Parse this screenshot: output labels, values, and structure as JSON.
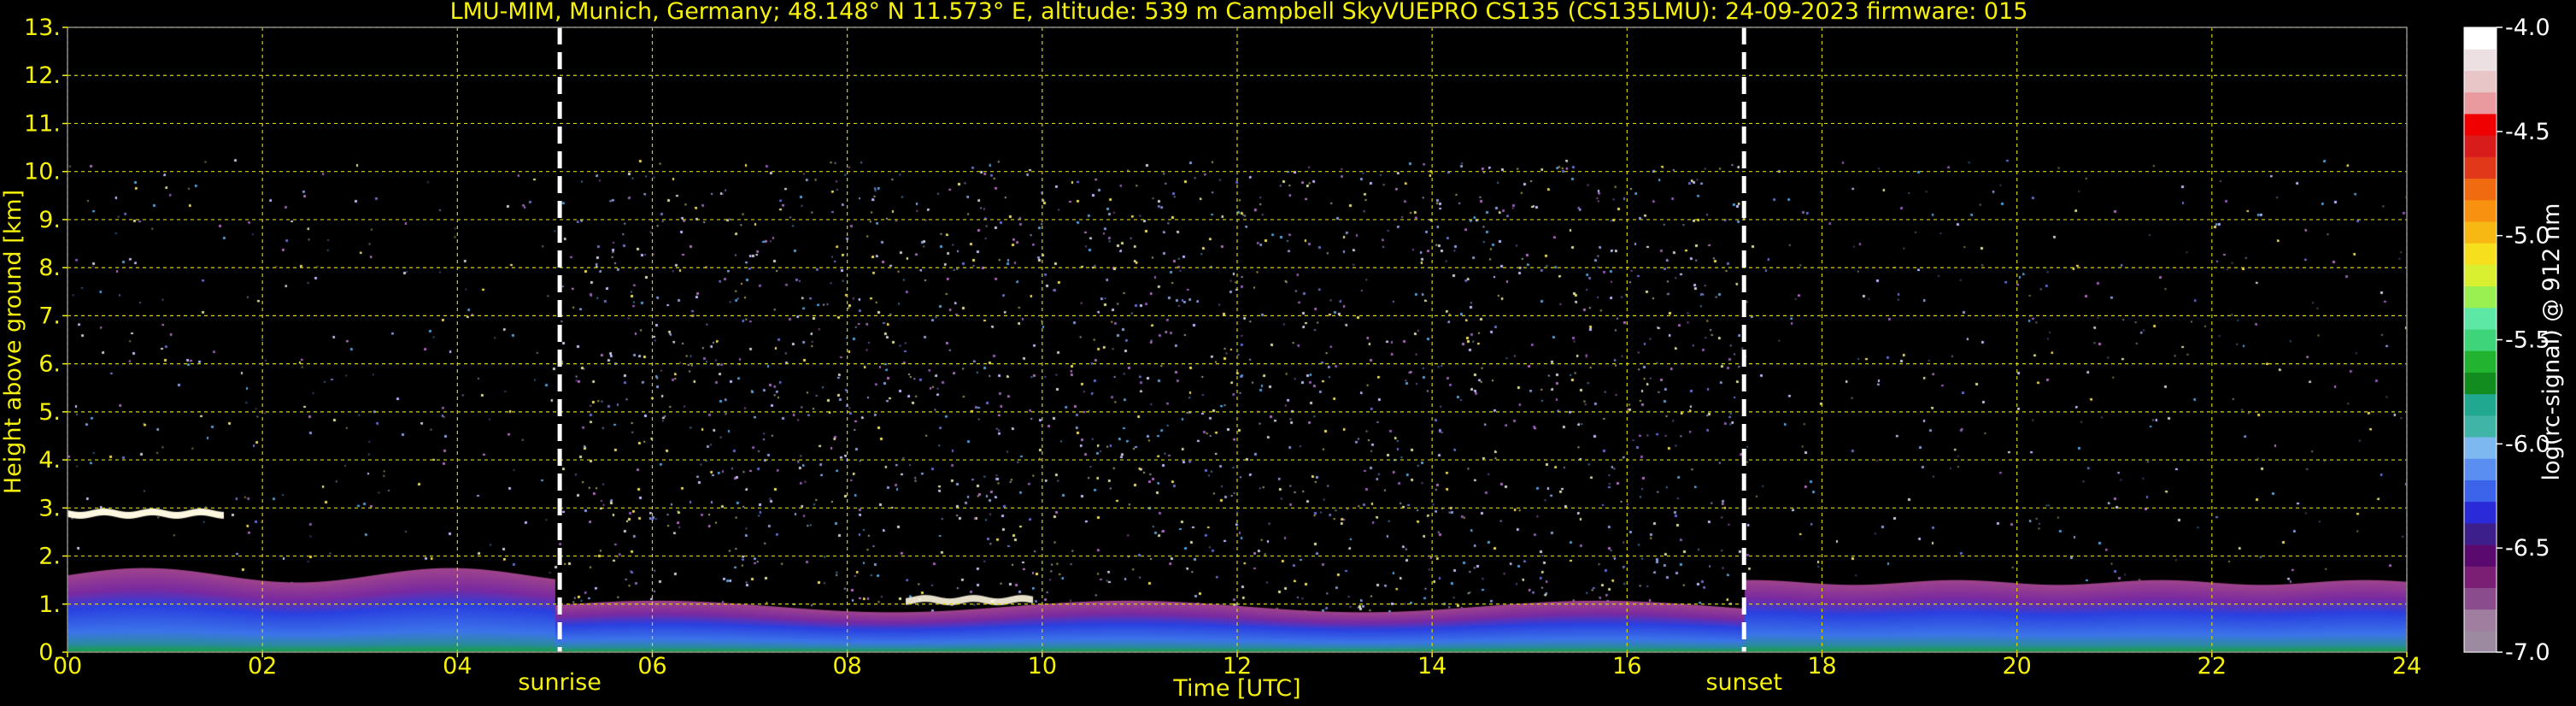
{
  "chart_data": {
    "type": "heatmap",
    "title": "LMU-MIM, Munich, Germany; 48.148° N 11.573° E, altitude: 539 m    Campbell SkyVUEPRO CS135 (CS135LMU): 24-09-2023    firmware: 015",
    "xlabel": "Time [UTC]",
    "ylabel": "Height above ground [km]",
    "xlim": [
      0,
      24
    ],
    "ylim": [
      0,
      13
    ],
    "x_ticks": [
      "00",
      "02",
      "04",
      "06",
      "08",
      "10",
      "12",
      "14",
      "16",
      "18",
      "20",
      "22",
      "24"
    ],
    "y_ticks": [
      "0.",
      "1.",
      "2.",
      "3.",
      "4.",
      "5.",
      "6.",
      "7.",
      "8.",
      "9.",
      "10.",
      "11.",
      "12.",
      "13."
    ],
    "grid": true,
    "markers": [
      {
        "label": "sunrise",
        "time": 5.05
      },
      {
        "label": "sunset",
        "time": 17.2
      }
    ],
    "colorbar": {
      "label": "log(rc-signal) @ 912 nm",
      "range": [
        -7.0,
        -4.0
      ],
      "ticks": [
        "-4.0",
        "-4.5",
        "-5.0",
        "-5.5",
        "-6.0",
        "-6.5",
        "-7.0"
      ],
      "colors": [
        "#9c8aa0",
        "#a07ea0",
        "#8a4c8c",
        "#7a1f74",
        "#5a0a6e",
        "#3d1f8c",
        "#2a2ad8",
        "#3c64ea",
        "#5a8ef0",
        "#7eb8f0",
        "#40b4a6",
        "#20a890",
        "#128c1e",
        "#22b430",
        "#3ed47a",
        "#5ee8a6",
        "#9af050",
        "#d8f030",
        "#f6e01e",
        "#f8b814",
        "#f89010",
        "#f06a10",
        "#e03818",
        "#d81c1c",
        "#f00000",
        "#e89a9e",
        "#e8c6c8",
        "#ece0e2",
        "#ffffff"
      ]
    },
    "layers": [
      {
        "name": "noise",
        "x_start": 0,
        "x_end": 24,
        "height_max_km": 10.25
      },
      {
        "name": "boundary-layer",
        "x_start": 0,
        "x_end": 24,
        "height_km": [
          0.1,
          1.9
        ]
      },
      {
        "name": "cloud",
        "x_start": 0,
        "x_end": 1.6,
        "height_km": 2.9
      },
      {
        "name": "cloud",
        "x_start": 8.6,
        "x_end": 9.9,
        "height_km": 1.1
      }
    ]
  }
}
